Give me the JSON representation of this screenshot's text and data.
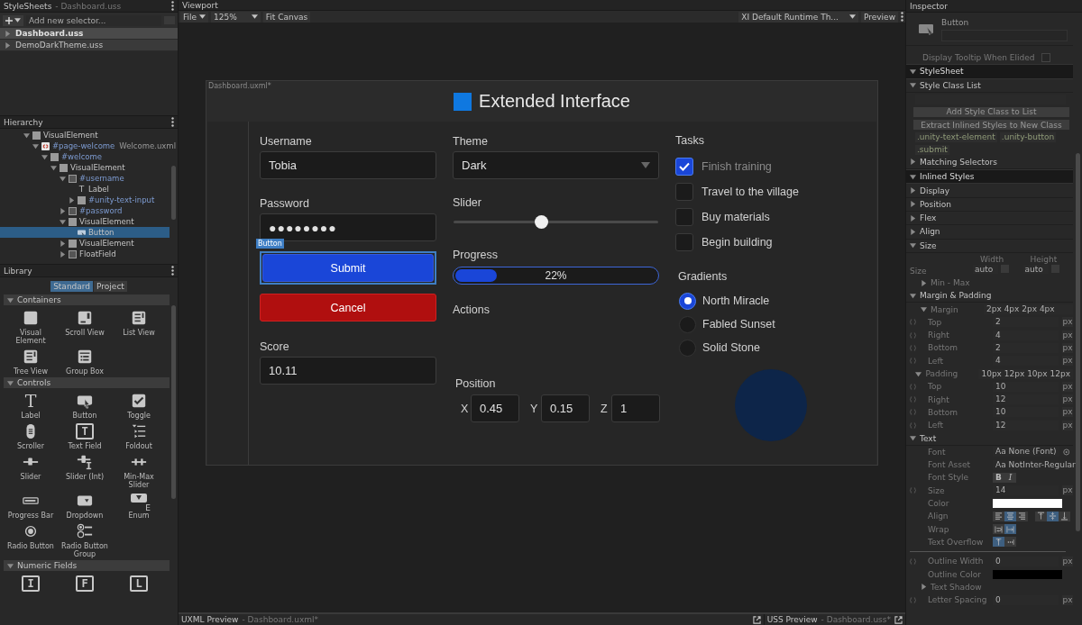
{
  "stylesheets": {
    "title": "StyleSheets",
    "subtitle": "- Dashboard.uss",
    "add_placeholder": "Add new selector...",
    "items": [
      {
        "label": "Dashboard.uss",
        "selected": true
      },
      {
        "label": "DemoDarkTheme.uss",
        "selected": false
      }
    ]
  },
  "hierarchy": {
    "title": "Hierarchy",
    "items": [
      {
        "label": "VisualElement",
        "kind": "element",
        "expanded": true,
        "named": false,
        "selected": false,
        "children": [
          {
            "label": "#page-welcome",
            "suffix": "Welcome.uxml",
            "kind": "template",
            "expanded": true,
            "named": true,
            "selected": false,
            "children": [
              {
                "label": "#welcome",
                "kind": "element",
                "expanded": true,
                "named": true,
                "selected": false,
                "children": [
                  {
                    "label": "VisualElement",
                    "kind": "element",
                    "expanded": true,
                    "named": false,
                    "selected": false,
                    "children": [
                      {
                        "label": "#username",
                        "kind": "field",
                        "expanded": true,
                        "named": true,
                        "selected": false,
                        "children": [
                          {
                            "label": "Label",
                            "kind": "label",
                            "glyph": "T",
                            "named": false,
                            "selected": false
                          },
                          {
                            "label": "#unity-text-input",
                            "kind": "element",
                            "expanded": false,
                            "named": true,
                            "selected": false
                          }
                        ]
                      },
                      {
                        "label": "#password",
                        "kind": "field",
                        "expanded": false,
                        "named": true,
                        "selected": false
                      },
                      {
                        "label": "VisualElement",
                        "kind": "element",
                        "expanded": true,
                        "named": false,
                        "selected": false,
                        "children": [
                          {
                            "label": "Button",
                            "kind": "button",
                            "named": false,
                            "selected": true
                          }
                        ]
                      },
                      {
                        "label": "VisualElement",
                        "kind": "element",
                        "expanded": false,
                        "named": false,
                        "selected": false
                      },
                      {
                        "label": "FloatField",
                        "kind": "field",
                        "expanded": false,
                        "named": false,
                        "selected": false
                      }
                    ]
                  }
                ]
              }
            ]
          }
        ]
      }
    ]
  },
  "library": {
    "title": "Library",
    "tabs": [
      {
        "label": "Standard",
        "selected": true
      },
      {
        "label": "Project",
        "selected": false
      }
    ],
    "sections": [
      {
        "label": "Containers",
        "expanded": true,
        "items": [
          {
            "label": "Visual Element",
            "kind": "visual-element"
          },
          {
            "label": "Scroll View",
            "kind": "scroll-view"
          },
          {
            "label": "List View",
            "kind": "list-view"
          },
          {
            "label": "Tree View",
            "kind": "tree-view"
          },
          {
            "label": "Group Box",
            "kind": "group-box"
          }
        ]
      },
      {
        "label": "Controls",
        "expanded": true,
        "items": [
          {
            "label": "Label",
            "kind": "glyph",
            "glyph": "T"
          },
          {
            "label": "Button",
            "kind": "button"
          },
          {
            "label": "Toggle",
            "kind": "toggle"
          },
          {
            "label": "Scroller",
            "kind": "scroller"
          },
          {
            "label": "Text Field",
            "kind": "boxed-glyph",
            "glyph": "T"
          },
          {
            "label": "Foldout",
            "kind": "foldout"
          },
          {
            "label": "Slider",
            "kind": "slider"
          },
          {
            "label": "Slider (Int)",
            "kind": "slider-int"
          },
          {
            "label": "Min-Max Slider",
            "kind": "min-max"
          },
          {
            "label": "Progress Bar",
            "kind": "progress"
          },
          {
            "label": "Dropdown",
            "kind": "dropdown"
          },
          {
            "label": "Enum",
            "kind": "enum",
            "glyph": "E"
          },
          {
            "label": "Radio Button",
            "kind": "radio"
          },
          {
            "label": "Radio Button Group",
            "kind": "radio-group"
          }
        ]
      },
      {
        "label": "Numeric Fields",
        "expanded": true,
        "items": [
          {
            "kind": "boxed-glyph",
            "glyph": "I"
          },
          {
            "kind": "boxed-glyph",
            "glyph": "F"
          },
          {
            "kind": "boxed-glyph",
            "glyph": "L"
          }
        ]
      }
    ]
  },
  "viewport": {
    "title": "Viewport",
    "toolbar": {
      "file": "File",
      "zoom": "125%",
      "fit": "Fit Canvas",
      "theme": "XI Default Runtime Th...",
      "preview": "Preview"
    },
    "document": {
      "title": "Dashboard.uxml*",
      "heading": "Extended Interface",
      "username": {
        "label": "Username",
        "value": "Tobia"
      },
      "password": {
        "label": "Password",
        "value": "●●●●●●●●"
      },
      "selection_tag": "Button",
      "submit": {
        "label": "Submit",
        "selected": true
      },
      "cancel": {
        "label": "Cancel"
      },
      "score": {
        "label": "Score",
        "value": "10.11"
      },
      "theme": {
        "label": "Theme",
        "value": "Dark"
      },
      "slider": {
        "label": "Slider",
        "level": 0.43
      },
      "progress": {
        "label": "Progress",
        "level": 0.22,
        "reading": "22%"
      },
      "actions": {
        "label": "Actions"
      },
      "position": {
        "label": "Position",
        "fields": [
          {
            "label": "X",
            "value": "0.45"
          },
          {
            "label": "Y",
            "value": "0.15"
          },
          {
            "label": "Z",
            "value": "1"
          }
        ]
      },
      "tasks": {
        "label": "Tasks",
        "items": [
          {
            "label": "Finish training",
            "checked": true
          },
          {
            "label": "Travel to the village",
            "checked": false
          },
          {
            "label": "Buy materials",
            "checked": false
          },
          {
            "label": "Begin building",
            "checked": false
          }
        ]
      },
      "gradients": {
        "label": "Gradients",
        "items": [
          {
            "label": "North Miracle",
            "selected": true
          },
          {
            "label": "Fabled Sunset",
            "selected": false
          },
          {
            "label": "Solid Stone",
            "selected": false
          }
        ]
      }
    },
    "bottom_bar": [
      {
        "title": "UXML Preview",
        "subtitle": "- Dashboard.uxml*"
      },
      {
        "title": "USS Preview",
        "subtitle": "- Dashboard.uss*"
      }
    ]
  },
  "inspector": {
    "title": "Inspector",
    "rows": [
      {
        "kind": "element",
        "label": "Button"
      },
      {
        "kind": "check",
        "label": "Display Tooltip When Elided",
        "checked": false
      },
      {
        "kind": "section",
        "label": "StyleSheet",
        "expanded": true
      },
      {
        "kind": "foldout",
        "label": "Style Class List",
        "expanded": true
      },
      {
        "kind": "input"
      },
      {
        "kind": "button",
        "label": "Add Style Class to List"
      },
      {
        "kind": "button",
        "label": "Extract Inlined Styles to New Class"
      },
      {
        "kind": "tags",
        "tags": [
          ".unity-text-element",
          ".unity-button",
          ".submit"
        ]
      },
      {
        "kind": "foldout",
        "label": "Matching Selectors",
        "expanded": false
      },
      {
        "kind": "section",
        "label": "Inlined Styles",
        "expanded": true
      },
      {
        "kind": "foldout",
        "label": "Display",
        "expanded": false
      },
      {
        "kind": "foldout",
        "label": "Position",
        "expanded": false
      },
      {
        "kind": "foldout",
        "label": "Flex",
        "expanded": false
      },
      {
        "kind": "foldout",
        "label": "Align",
        "expanded": false
      },
      {
        "kind": "foldout",
        "label": "Size",
        "expanded": true
      },
      {
        "kind": "size",
        "label": "Size",
        "columns": [
          {
            "label": "Width",
            "value": "auto"
          },
          {
            "label": "Height",
            "value": "auto"
          }
        ]
      },
      {
        "kind": "subfoldout",
        "label": "Min - Max",
        "expanded": false
      },
      {
        "kind": "foldout",
        "label": "Margin & Padding",
        "expanded": true
      },
      {
        "kind": "subfoldout",
        "label": "Margin",
        "expanded": true,
        "value": "2px 4px 2px 4px"
      },
      {
        "kind": "field",
        "label": "Top",
        "value": "2",
        "unit": "px"
      },
      {
        "kind": "field",
        "label": "Right",
        "value": "4",
        "unit": "px"
      },
      {
        "kind": "field",
        "label": "Bottom",
        "value": "2",
        "unit": "px"
      },
      {
        "kind": "field",
        "label": "Left",
        "value": "4",
        "unit": "px"
      },
      {
        "kind": "subfoldout",
        "label": "Padding",
        "expanded": true,
        "value": "10px 12px 10px 12px"
      },
      {
        "kind": "field",
        "label": "Top",
        "value": "10",
        "unit": "px"
      },
      {
        "kind": "field",
        "label": "Right",
        "value": "12",
        "unit": "px"
      },
      {
        "kind": "field",
        "label": "Bottom",
        "value": "10",
        "unit": "px"
      },
      {
        "kind": "field",
        "label": "Left",
        "value": "12",
        "unit": "px"
      },
      {
        "kind": "foldout",
        "label": "Text",
        "expanded": true
      },
      {
        "kind": "asset",
        "label": "Font",
        "prefix": "Aa",
        "value": "None (Font)"
      },
      {
        "kind": "asset",
        "label": "Font Asset",
        "prefix": "Aa",
        "value": "NotInter-Regular"
      },
      {
        "kind": "toggles",
        "label": "Font Style",
        "options": [
          {
            "glyph": "B",
            "selected": false
          },
          {
            "glyph": "I",
            "selected": false
          }
        ]
      },
      {
        "kind": "field",
        "label": "Size",
        "value": "14",
        "unit": "px"
      },
      {
        "kind": "color",
        "label": "Color",
        "color": "#ffffff"
      },
      {
        "kind": "toggles",
        "label": "Align",
        "options": [
          {
            "kind": "align-left",
            "selected": false
          },
          {
            "kind": "align-center",
            "selected": true
          },
          {
            "kind": "align-right",
            "selected": false
          },
          {
            "kind": "align-top",
            "selected": false
          },
          {
            "kind": "align-middle",
            "selected": true
          },
          {
            "kind": "align-bottom",
            "selected": false
          }
        ]
      },
      {
        "kind": "toggles",
        "label": "Wrap",
        "options": [
          {
            "kind": "wrap",
            "selected": false
          },
          {
            "kind": "no-wrap",
            "selected": true
          }
        ]
      },
      {
        "kind": "toggles",
        "label": "Text Overflow",
        "options": [
          {
            "kind": "clip",
            "selected": true
          },
          {
            "kind": "ellipsis",
            "selected": false
          }
        ]
      },
      {
        "kind": "divider"
      },
      {
        "kind": "field",
        "label": "Outline Width",
        "value": "0",
        "unit": "px"
      },
      {
        "kind": "color",
        "label": "Outline Color",
        "color": "#000000"
      },
      {
        "kind": "subfoldout",
        "label": "Text Shadow",
        "expanded": false
      },
      {
        "kind": "field",
        "label": "Letter Spacing",
        "value": "0",
        "unit": "px"
      }
    ]
  }
}
